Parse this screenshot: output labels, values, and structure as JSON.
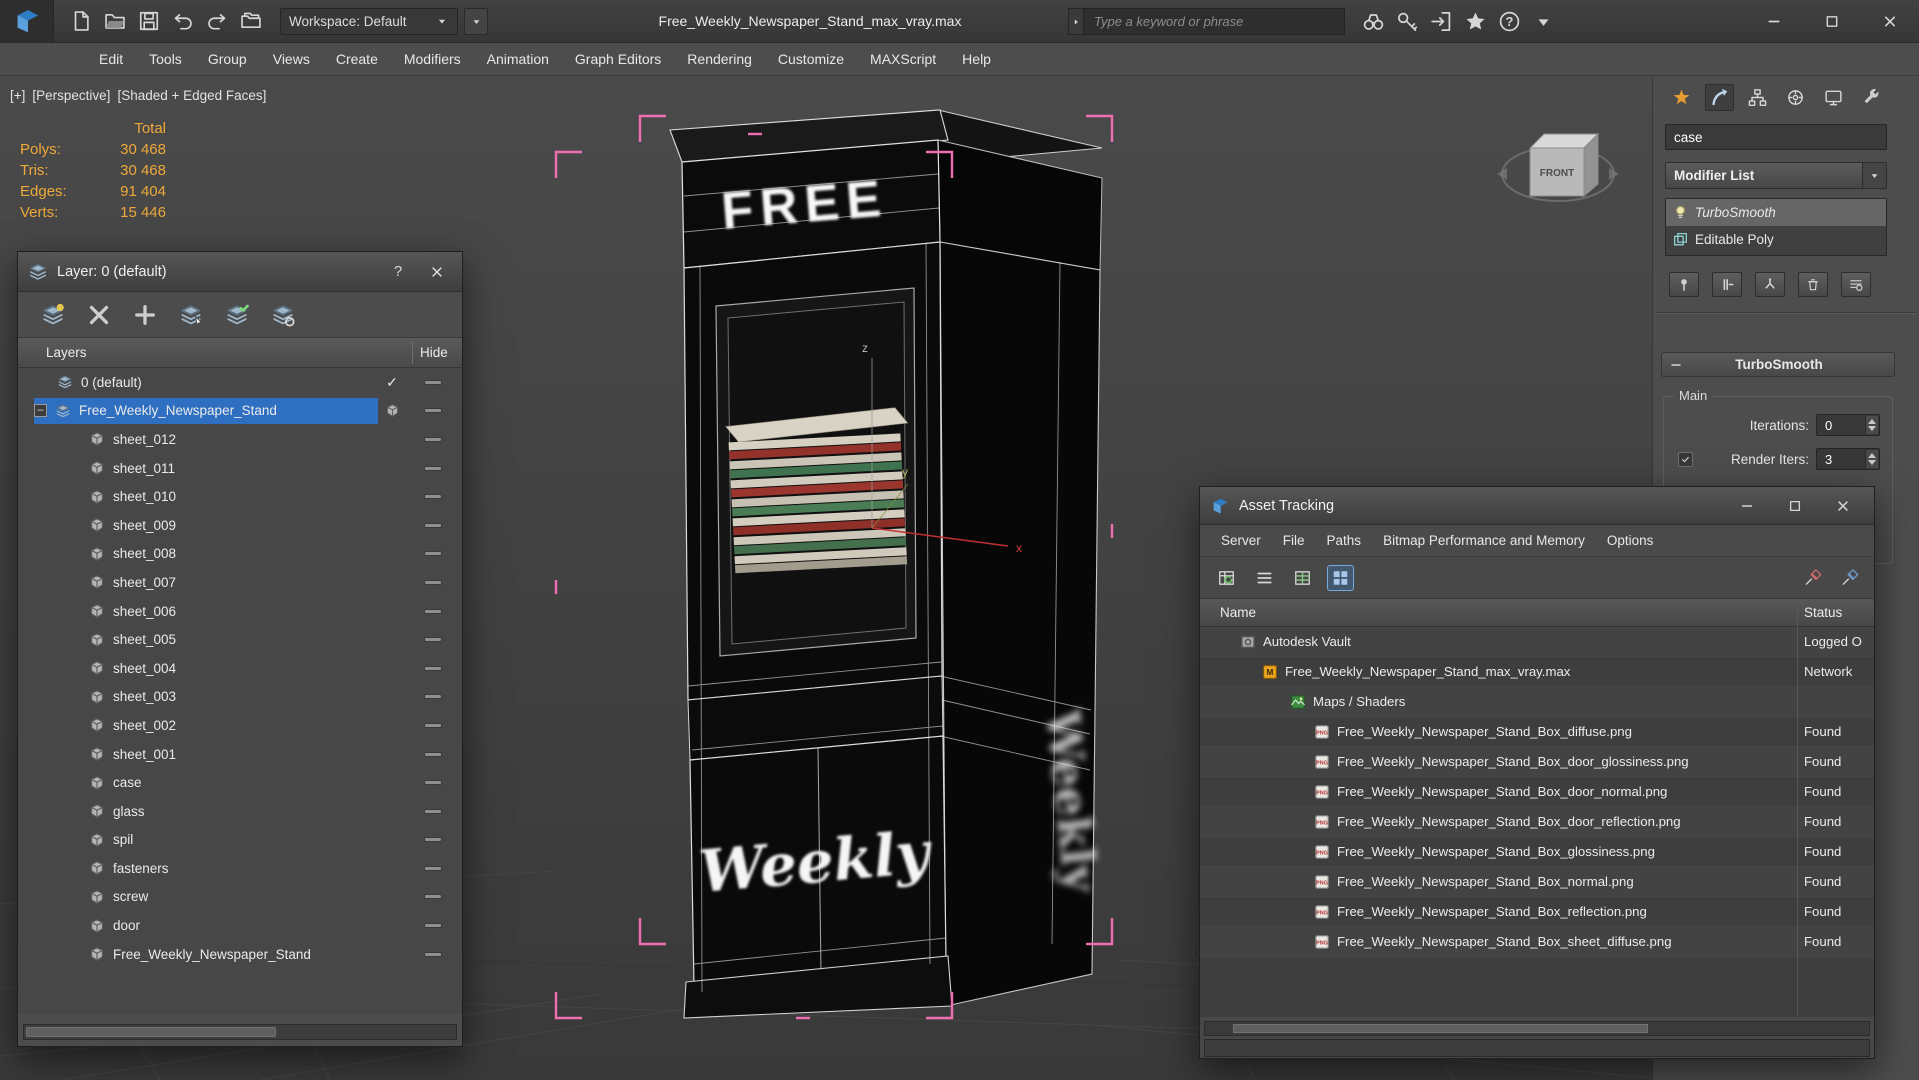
{
  "app": {
    "title": "Free_Weekly_Newspaper_Stand_max_vray.max",
    "workspace_label": "Workspace: Default",
    "search_placeholder": "Type a keyword or phrase",
    "menu_items": [
      "Edit",
      "Tools",
      "Group",
      "Views",
      "Create",
      "Modifiers",
      "Animation",
      "Graph Editors",
      "Rendering",
      "Customize",
      "MAXScript",
      "Help"
    ],
    "quick_access_icons": [
      "new-scene",
      "open-file",
      "save-file",
      "undo",
      "redo",
      "project-folder"
    ],
    "search_icons": [
      "search-binoculars",
      "key",
      "sign-in",
      "favorites-star",
      "help",
      "caret-down"
    ],
    "window_icons": [
      "minimize",
      "maximize",
      "close"
    ]
  },
  "viewport": {
    "label_segments": [
      "[+]",
      "[Perspective]",
      "[Shaded + Edged Faces]"
    ],
    "stats": {
      "header": "Total",
      "rows": [
        {
          "label": "Polys:",
          "value": "30 468"
        },
        {
          "label": "Tris:",
          "value": "30 468"
        },
        {
          "label": "Edges:",
          "value": "91 404"
        },
        {
          "label": "Verts:",
          "value": "15 446"
        }
      ]
    },
    "model": {
      "sign_top": "FREE",
      "sign_bottom": "Weekly"
    },
    "axis_labels": {
      "x": "x",
      "y": "y",
      "z": "z"
    },
    "viewcube": {
      "front": "FRONT"
    }
  },
  "layer_dialog": {
    "title": "Layer: 0 (default)",
    "help_button": "?",
    "toolbar_icons": [
      "new-layer",
      "delete-layer",
      "add-to-layer",
      "select-layer-objects",
      "set-current-layer",
      "layer-properties"
    ],
    "header": {
      "layers": "Layers",
      "hide": "Hide"
    },
    "rows": [
      {
        "label": "0 (default)",
        "icon": "layer",
        "indent": 0,
        "mark": "check"
      },
      {
        "label": "Free_Weekly_Newspaper_Stand",
        "icon": "layer",
        "indent": 0,
        "mark": "box",
        "expander": "minus",
        "selected": true
      },
      {
        "label": "sheet_012",
        "icon": "object",
        "indent": 1
      },
      {
        "label": "sheet_011",
        "icon": "object",
        "indent": 1
      },
      {
        "label": "sheet_010",
        "icon": "object",
        "indent": 1
      },
      {
        "label": "sheet_009",
        "icon": "object",
        "indent": 1
      },
      {
        "label": "sheet_008",
        "icon": "object",
        "indent": 1
      },
      {
        "label": "sheet_007",
        "icon": "object",
        "indent": 1
      },
      {
        "label": "sheet_006",
        "icon": "object",
        "indent": 1
      },
      {
        "label": "sheet_005",
        "icon": "object",
        "indent": 1
      },
      {
        "label": "sheet_004",
        "icon": "object",
        "indent": 1
      },
      {
        "label": "sheet_003",
        "icon": "object",
        "indent": 1
      },
      {
        "label": "sheet_002",
        "icon": "object",
        "indent": 1
      },
      {
        "label": "sheet_001",
        "icon": "object",
        "indent": 1
      },
      {
        "label": "case",
        "icon": "object",
        "indent": 1
      },
      {
        "label": "glass",
        "icon": "object",
        "indent": 1
      },
      {
        "label": "spil",
        "icon": "object",
        "indent": 1
      },
      {
        "label": "fasteners",
        "icon": "object",
        "indent": 1
      },
      {
        "label": "screw",
        "icon": "object",
        "indent": 1
      },
      {
        "label": "door",
        "icon": "object",
        "indent": 1
      },
      {
        "label": "Free_Weekly_Newspaper_Stand",
        "icon": "object",
        "indent": 1
      }
    ]
  },
  "asset_tracking": {
    "title": "Asset Tracking",
    "menu_items": [
      "Server",
      "File",
      "Paths",
      "Bitmap Performance and Memory",
      "Options"
    ],
    "toolbar_icons_left": [
      "refresh-bitmaps",
      "view-list",
      "view-table",
      "view-grid"
    ],
    "toolbar_icons_right": [
      "set-path",
      "strip-path"
    ],
    "window_icons": [
      "minimize",
      "maximize",
      "close"
    ],
    "columns": {
      "name": "Name",
      "status": "Status"
    },
    "rows": [
      {
        "name": "Autodesk Vault",
        "status": "Logged O",
        "icon": "vault",
        "indent": 0
      },
      {
        "name": "Free_Weekly_Newspaper_Stand_max_vray.max",
        "status": "Network",
        "icon": "max-file",
        "indent": 1
      },
      {
        "name": "Maps / Shaders",
        "status": "",
        "icon": "maps-shaders",
        "indent": 2
      },
      {
        "name": "Free_Weekly_Newspaper_Stand_Box_diffuse.png",
        "status": "Found",
        "icon": "png-file",
        "indent": 3
      },
      {
        "name": "Free_Weekly_Newspaper_Stand_Box_door_glossiness.png",
        "status": "Found",
        "icon": "png-file",
        "indent": 3
      },
      {
        "name": "Free_Weekly_Newspaper_Stand_Box_door_normal.png",
        "status": "Found",
        "icon": "png-file",
        "indent": 3
      },
      {
        "name": "Free_Weekly_Newspaper_Stand_Box_door_reflection.png",
        "status": "Found",
        "icon": "png-file",
        "indent": 3
      },
      {
        "name": "Free_Weekly_Newspaper_Stand_Box_glossiness.png",
        "status": "Found",
        "icon": "png-file",
        "indent": 3
      },
      {
        "name": "Free_Weekly_Newspaper_Stand_Box_normal.png",
        "status": "Found",
        "icon": "png-file",
        "indent": 3
      },
      {
        "name": "Free_Weekly_Newspaper_Stand_Box_reflection.png",
        "status": "Found",
        "icon": "png-file",
        "indent": 3
      },
      {
        "name": "Free_Weekly_Newspaper_Stand_Box_sheet_diffuse.png",
        "status": "Found",
        "icon": "png-file",
        "indent": 3
      }
    ]
  },
  "command_panel": {
    "tabs": [
      "tab-create",
      "tab-modify",
      "tab-hierarchy",
      "tab-motion",
      "tab-display",
      "tab-utilities"
    ],
    "object_name": "case",
    "modifier_list_label": "Modifier List",
    "stack": [
      {
        "label": "TurboSmooth",
        "icon": "bulb-on",
        "selected": true,
        "italic": true
      },
      {
        "label": "Editable Poly",
        "icon": "editable-poly"
      }
    ],
    "stack_buttons": [
      "pin-stack",
      "show-end-result",
      "make-unique",
      "remove-modifier",
      "configure-modifier-sets"
    ],
    "rollout": {
      "title": "TurboSmooth",
      "group": "Main",
      "iterations_label": "Iterations:",
      "iterations_value": "0",
      "render_iters_label": "Render Iters:",
      "render_iters_value": "3",
      "render_iters_checked": true
    }
  },
  "colors": {
    "selection_blue": "#2e6fc2",
    "stats_orange": "#efa93a",
    "selection_pink": "#ee6fb2",
    "ui_gray": "#4d4d4d"
  }
}
